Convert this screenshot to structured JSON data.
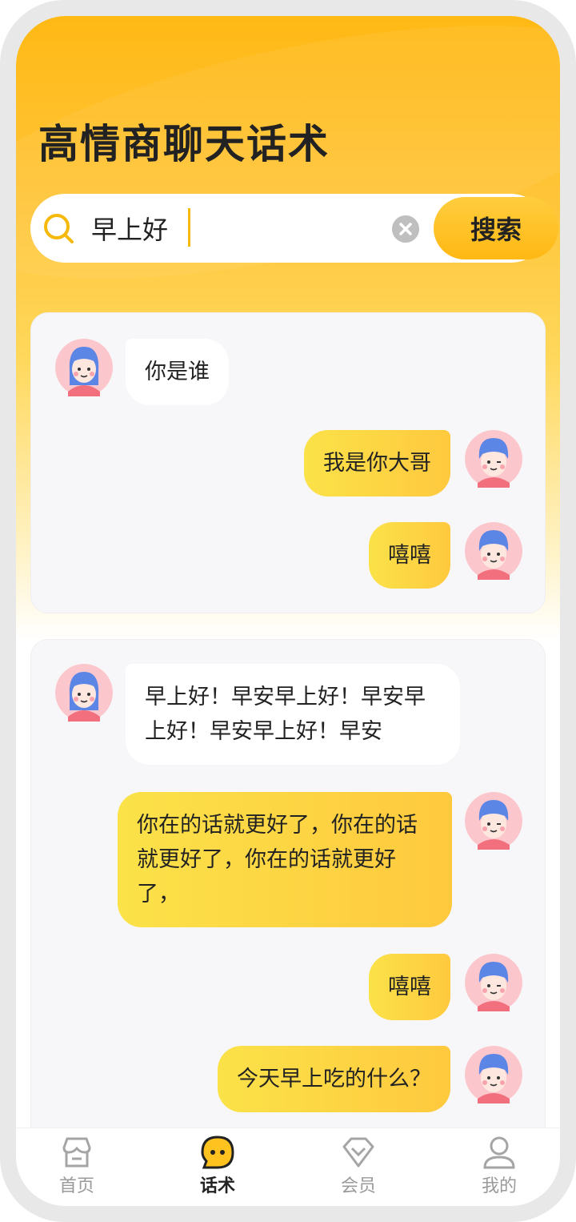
{
  "header": {
    "title": "高情商聊天话术"
  },
  "search": {
    "value": "早上好",
    "button_label": "搜索"
  },
  "cards": [
    {
      "messages": [
        {
          "side": "left",
          "text": "你是谁"
        },
        {
          "side": "right",
          "text": "我是你大哥"
        },
        {
          "side": "right",
          "text": "嘻嘻"
        }
      ]
    },
    {
      "messages": [
        {
          "side": "left",
          "text": "早上好！早安早上好！早安早上好！早安早上好！早安"
        },
        {
          "side": "right",
          "text": "你在的话就更好了，你在的话就更好了，你在的话就更好了，"
        },
        {
          "side": "right",
          "text": "嘻嘻"
        },
        {
          "side": "right",
          "text": "今天早上吃的什么？"
        }
      ]
    }
  ],
  "tabbar": {
    "items": [
      {
        "label": "首页",
        "icon": "store-icon"
      },
      {
        "label": "话术",
        "icon": "chat-bubble-icon",
        "active": true
      },
      {
        "label": "会员",
        "icon": "diamond-icon"
      },
      {
        "label": "我的",
        "icon": "user-icon"
      }
    ]
  },
  "colors": {
    "accent": "#FFB915",
    "bubble_right": "#FBE249",
    "bubble_left": "#FFFFFF"
  }
}
